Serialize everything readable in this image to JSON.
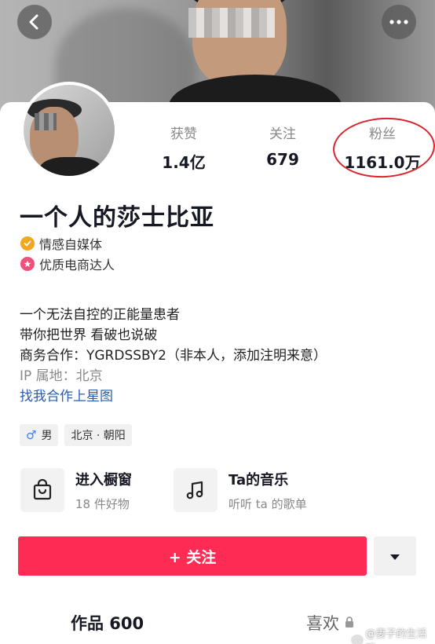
{
  "header": {
    "back_icon": "chevron-left-icon",
    "more_icon": "more-horizontal-icon"
  },
  "stats": {
    "likes_label": "获赞",
    "likes_value": "1.4亿",
    "following_label": "关注",
    "following_value": "679",
    "fans_label": "粉丝",
    "fans_value": "1161.0万"
  },
  "profile": {
    "name": "一个人的莎士比亚",
    "badges": [
      {
        "icon": "check-badge-icon",
        "label": "情感自媒体",
        "color": "#f0a81e"
      },
      {
        "icon": "star-badge-icon",
        "label": "优质电商达人",
        "color": "#f2507b"
      }
    ],
    "bio_lines": [
      "一个无法自控的正能量患者",
      "带你把世界 看破也说破",
      "商务合作：YGRDSSBY2（非本人，添加注明来意）"
    ],
    "ip": "IP 属地：北京",
    "link": "找我合作上星图",
    "tags": [
      {
        "icon": "male-icon",
        "label": "男"
      },
      {
        "label": "北京 · 朝阳"
      }
    ]
  },
  "features": {
    "shop": {
      "icon": "shopping-bag-icon",
      "title": "进入橱窗",
      "subtitle": "18 件好物"
    },
    "music": {
      "icon": "music-note-icon",
      "title": "Ta的音乐",
      "subtitle": "听听 ta 的歌单"
    }
  },
  "actions": {
    "follow_label": "+ 关注",
    "dropdown_icon": "caret-down-icon"
  },
  "tabs": {
    "works": "作品 600",
    "likes": "喜欢"
  },
  "watermark": "@妻子的生活观",
  "colors": {
    "accent": "#fe2c55",
    "link": "#2a5db0",
    "annotation": "#d6262b"
  }
}
